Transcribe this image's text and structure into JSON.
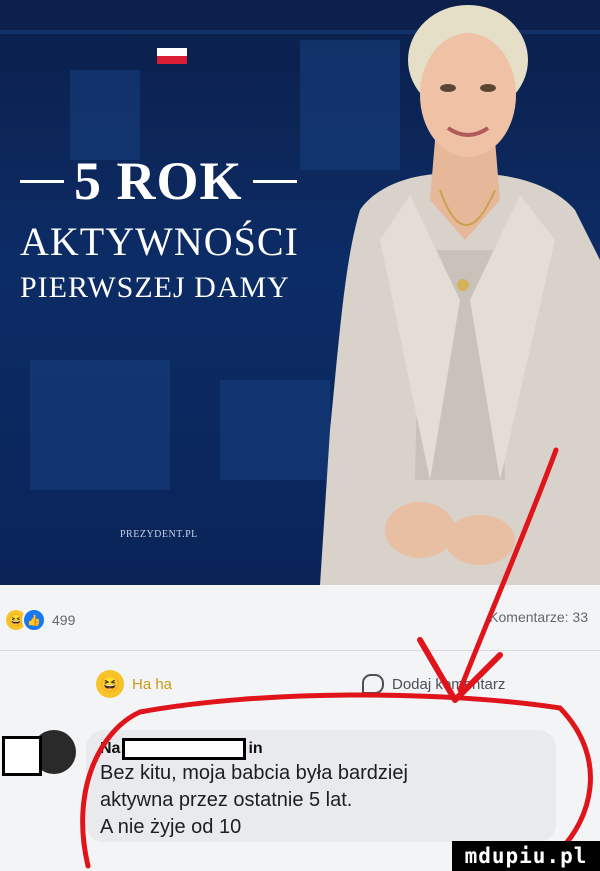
{
  "banner": {
    "title_number": "5 ROK",
    "title_line2": "AKTYWNOŚCI",
    "title_line3": "PIERWSZEJ DAMY",
    "site": "PREZYDENT.PL"
  },
  "post_stats": {
    "reaction_count": "499",
    "comments": "Komentarze: 33"
  },
  "actions": {
    "haha_label": "Ha ha",
    "comment_label": "Dodaj komentarz"
  },
  "comment": {
    "name_prefix": "Na",
    "name_suffix": "in",
    "text": "Bez kitu, moja babcia była bardziej\naktywna przez ostatnie 5 lat.\nA nie żyje od 10"
  },
  "watermark": "mdupiu.pl",
  "colors": {
    "banner_blue": "#0c2c66",
    "annotation_red": "#e0151c",
    "like_blue": "#1877f2",
    "emoji_yellow": "#f7c328"
  },
  "icons": [
    "polish-flag-icon",
    "haha-emoji-icon",
    "like-icon",
    "comment-bubble-icon"
  ]
}
